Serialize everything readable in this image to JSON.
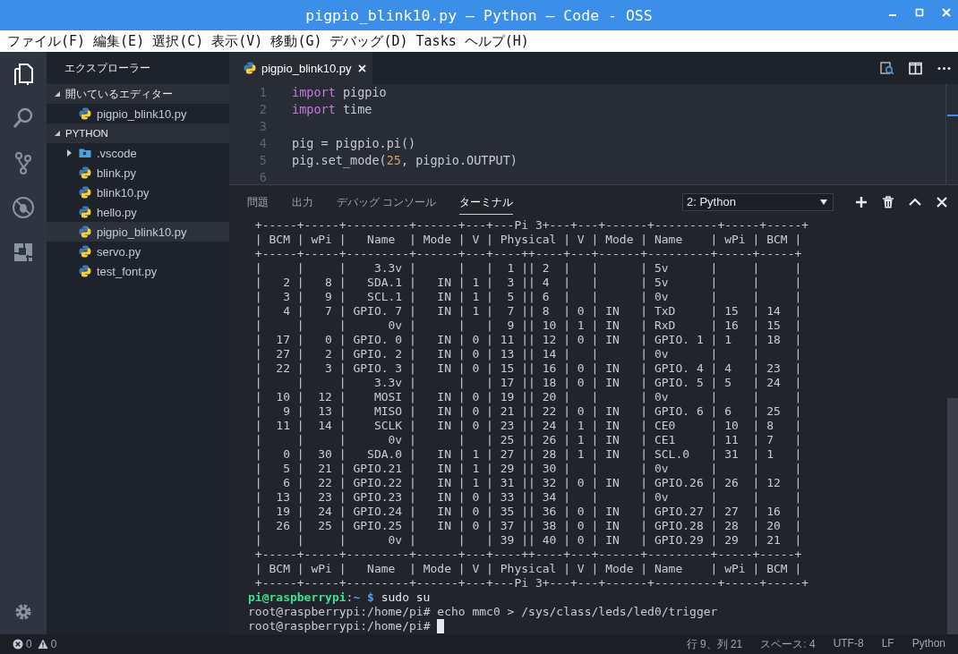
{
  "window": {
    "title": "pigpio_blink10.py — Python — Code - OSS"
  },
  "menu": [
    "ファイル(F)",
    "編集(E)",
    "選択(C)",
    "表示(V)",
    "移動(G)",
    "デバッグ(D)",
    "Tasks",
    "ヘルプ(H)"
  ],
  "activity_bar": [
    {
      "kind": "files",
      "selected": true
    },
    {
      "kind": "search",
      "selected": false
    },
    {
      "kind": "source-control",
      "selected": false
    },
    {
      "kind": "debug",
      "selected": false
    },
    {
      "kind": "extensions",
      "selected": false
    }
  ],
  "manage": {
    "kind": "settings"
  },
  "sidebar": {
    "title": "エクスプローラー",
    "sections": [
      {
        "label": "開いているエディター",
        "expanded": true,
        "items": [
          {
            "label": "pigpio_blink10.py",
            "kind": "python",
            "selected": false
          }
        ]
      },
      {
        "label": "PYTHON",
        "expanded": true,
        "items": [
          {
            "label": ".vscode",
            "kind": "folder",
            "expanded": false,
            "selected": false
          },
          {
            "label": "blink.py",
            "kind": "python",
            "selected": false
          },
          {
            "label": "blink10.py",
            "kind": "python",
            "selected": false
          },
          {
            "label": "hello.py",
            "kind": "python",
            "selected": false
          },
          {
            "label": "pigpio_blink10.py",
            "kind": "python",
            "selected": true
          },
          {
            "label": "servo.py",
            "kind": "python",
            "selected": false
          },
          {
            "label": "test_font.py",
            "kind": "python",
            "selected": false
          }
        ]
      }
    ]
  },
  "editor": {
    "tabs": [
      {
        "label": "pigpio_blink10.py",
        "kind": "python",
        "selected": true
      }
    ],
    "actions": [
      {
        "kind": "preview"
      },
      {
        "kind": "split"
      },
      {
        "kind": "more"
      }
    ],
    "lines": [
      {
        "number": "1",
        "tokens": [
          {
            "kind": "keyword",
            "text": "import"
          },
          {
            "kind": "plain",
            "text": " pigpio"
          }
        ]
      },
      {
        "number": "2",
        "tokens": [
          {
            "kind": "keyword",
            "text": "import"
          },
          {
            "kind": "plain",
            "text": " time"
          }
        ]
      },
      {
        "number": "3"
      },
      {
        "number": "4",
        "tokens": [
          {
            "kind": "plain",
            "text": "pig = pigpio.pi()"
          }
        ]
      },
      {
        "number": "5",
        "tokens": [
          {
            "kind": "plain",
            "text": "pig.set_mode("
          },
          {
            "kind": "number",
            "text": "25"
          },
          {
            "kind": "plain",
            "text": ", pigpio.OUTPUT)"
          }
        ]
      },
      {
        "number": "6"
      }
    ]
  },
  "panel": {
    "tabs": [
      {
        "label": "問題",
        "selected": false
      },
      {
        "label": "出力",
        "selected": false
      },
      {
        "label": "デバッグ コンソール",
        "selected": false
      },
      {
        "label": "ターミナル",
        "selected": true
      }
    ],
    "terminal_select": {
      "value": "2: Python"
    },
    "actions": [
      {
        "kind": "add"
      },
      {
        "kind": "trash"
      },
      {
        "kind": "maximize"
      },
      {
        "kind": "close"
      }
    ],
    "terminal": [
      {
        "kind": "output",
        "text": " +-----+-----+---------+------+---+---Pi 3+---+---+------+---------+-----+-----+"
      },
      {
        "kind": "output",
        "text": " | BCM | wPi |   Name  | Mode | V | Physical | V | Mode | Name    | wPi | BCM |"
      },
      {
        "kind": "output",
        "text": " +-----+-----+---------+------+---+----++----+---+------+---------+-----+-----+"
      },
      {
        "kind": "output",
        "text": " |     |     |    3.3v |      |   |  1 || 2  |   |      | 5v      |     |     |"
      },
      {
        "kind": "output",
        "text": " |   2 |   8 |   SDA.1 |   IN | 1 |  3 || 4  |   |      | 5v      |     |     |"
      },
      {
        "kind": "output",
        "text": " |   3 |   9 |   SCL.1 |   IN | 1 |  5 || 6  |   |      | 0v      |     |     |"
      },
      {
        "kind": "output",
        "text": " |   4 |   7 | GPIO. 7 |   IN | 1 |  7 || 8  | 0 | IN   | TxD     | 15  | 14  |"
      },
      {
        "kind": "output",
        "text": " |     |     |      0v |      |   |  9 || 10 | 1 | IN   | RxD     | 16  | 15  |"
      },
      {
        "kind": "output",
        "text": " |  17 |   0 | GPIO. 0 |   IN | 0 | 11 || 12 | 0 | IN   | GPIO. 1 | 1   | 18  |"
      },
      {
        "kind": "output",
        "text": " |  27 |   2 | GPIO. 2 |   IN | 0 | 13 || 14 |   |      | 0v      |     |     |"
      },
      {
        "kind": "output",
        "text": " |  22 |   3 | GPIO. 3 |   IN | 0 | 15 || 16 | 0 | IN   | GPIO. 4 | 4   | 23  |"
      },
      {
        "kind": "output",
        "text": " |     |     |    3.3v |      |   | 17 || 18 | 0 | IN   | GPIO. 5 | 5   | 24  |"
      },
      {
        "kind": "output",
        "text": " |  10 |  12 |    MOSI |   IN | 0 | 19 || 20 |   |      | 0v      |     |     |"
      },
      {
        "kind": "output",
        "text": " |   9 |  13 |    MISO |   IN | 0 | 21 || 22 | 0 | IN   | GPIO. 6 | 6   | 25  |"
      },
      {
        "kind": "output",
        "text": " |  11 |  14 |    SCLK |   IN | 0 | 23 || 24 | 1 | IN   | CE0     | 10  | 8   |"
      },
      {
        "kind": "output",
        "text": " |     |     |      0v |      |   | 25 || 26 | 1 | IN   | CE1     | 11  | 7   |"
      },
      {
        "kind": "output",
        "text": " |   0 |  30 |   SDA.0 |   IN | 1 | 27 || 28 | 1 | IN   | SCL.0   | 31  | 1   |"
      },
      {
        "kind": "output",
        "text": " |   5 |  21 | GPIO.21 |   IN | 1 | 29 || 30 |   |      | 0v      |     |     |"
      },
      {
        "kind": "output",
        "text": " |   6 |  22 | GPIO.22 |   IN | 1 | 31 || 32 | 0 | IN   | GPIO.26 | 26  | 12  |"
      },
      {
        "kind": "output",
        "text": " |  13 |  23 | GPIO.23 |   IN | 0 | 33 || 34 |   |      | 0v      |     |     |"
      },
      {
        "kind": "output",
        "text": " |  19 |  24 | GPIO.24 |   IN | 0 | 35 || 36 | 0 | IN   | GPIO.27 | 27  | 16  |"
      },
      {
        "kind": "output",
        "text": " |  26 |  25 | GPIO.25 |   IN | 0 | 37 || 38 | 0 | IN   | GPIO.28 | 28  | 20  |"
      },
      {
        "kind": "output",
        "text": " |     |     |      0v |      |   | 39 || 40 | 0 | IN   | GPIO.29 | 29  | 21  |"
      },
      {
        "kind": "output",
        "text": " +-----+-----+---------+------+---+----++----+---+------+---------+-----+-----+"
      },
      {
        "kind": "output",
        "text": " | BCM | wPi |   Name  | Mode | V | Physical | V | Mode | Name    | wPi | BCM |"
      },
      {
        "kind": "output",
        "text": " +-----+-----+---------+------+---+---Pi 3+---+---+------+---------+-----+-----+"
      },
      {
        "kind": "prompt",
        "user": "pi@raspberrypi",
        "separator": ":",
        "path": "~",
        "symbol": "$",
        "command": "sudo su"
      },
      {
        "kind": "output",
        "text": "root@raspberrypi:/home/pi# echo mmc0 > /sys/class/leds/led0/trigger"
      },
      {
        "kind": "input",
        "text": "root@raspberrypi:/home/pi#",
        "cursor": true
      }
    ]
  },
  "status_bar": {
    "left": [
      {
        "kind": "errors",
        "count": "0"
      },
      {
        "kind": "warnings",
        "count": "0"
      }
    ],
    "right": [
      "行 9、列 21",
      "スペース: 4",
      "UTF-8",
      "LF",
      "Python"
    ]
  }
}
